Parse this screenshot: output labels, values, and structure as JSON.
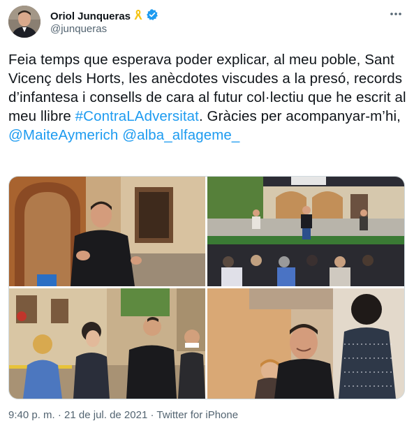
{
  "author": {
    "display_name": "Oriol Junqueras",
    "handle": "@junqueras",
    "ribbon_color": "#f5c518",
    "verified_color": "#1d9bf0",
    "avatar_icon": "avatar-photo",
    "more_icon": "more-dots-icon"
  },
  "tweet": {
    "segments": [
      {
        "text": "Feia temps que esperava poder explicar, al meu poble, Sant Vicenç dels Horts, les anècdotes viscudes a la presó, records d’infantesa i consells de cara al futur col·lectiu que he escrit al meu llibre ",
        "type": "text"
      },
      {
        "text": "#ContraLAdversitat",
        "type": "hashtag"
      },
      {
        "text": ". Gràcies per acompanyar-m’hi, ",
        "type": "text"
      },
      {
        "text": "@MaiteAymerich",
        "type": "mention"
      },
      {
        "text": " ",
        "type": "text"
      },
      {
        "text": "@alba_alfageme_",
        "type": "mention"
      }
    ]
  },
  "media": {
    "photos": [
      {
        "name": "photo-speaker-portrait"
      },
      {
        "name": "photo-stage-event"
      },
      {
        "name": "photo-street-crowd"
      },
      {
        "name": "photo-smiling-closeup"
      }
    ]
  },
  "footer": {
    "timestamp": "9:40 p. m. · 21 de jul. de 2021 · Twitter for iPhone"
  },
  "colors": {
    "link": "#1d9bf0",
    "text": "#0f1419",
    "secondary": "#536471"
  }
}
